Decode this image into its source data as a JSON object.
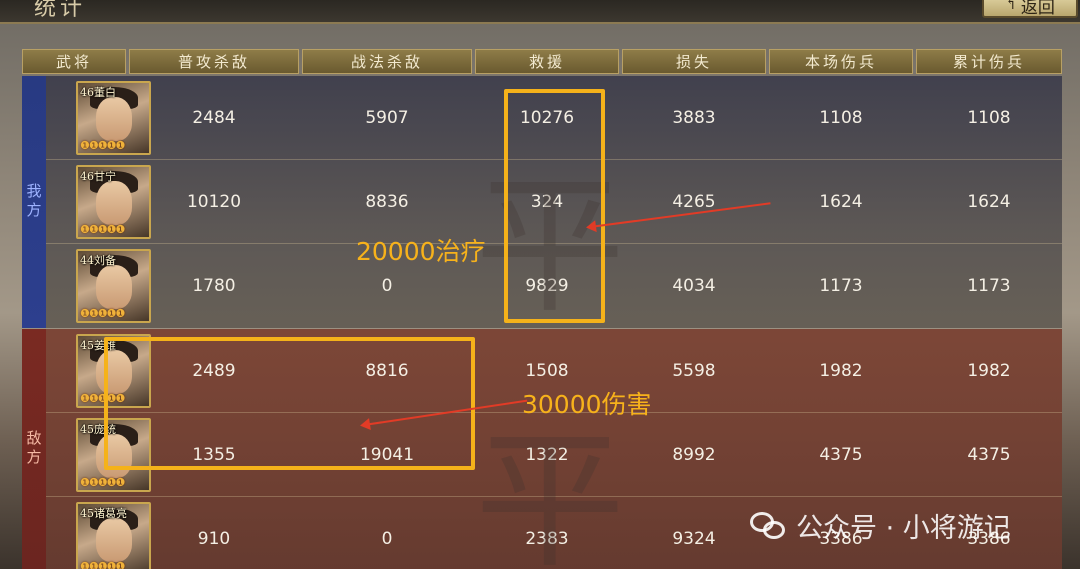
{
  "window": {
    "title": "统计",
    "back_label": "返回"
  },
  "headers": [
    "武将",
    "普攻杀敌",
    "战法杀敌",
    "救援",
    "损失",
    "本场伤兵",
    "累计伤兵"
  ],
  "ally": {
    "side_label": "我方",
    "rows": [
      {
        "hero": "46董白",
        "normal_kill": "2484",
        "skill_kill": "5907",
        "rescue": "10276",
        "loss": "3883",
        "wounded": "1108",
        "total_wounded": "1108"
      },
      {
        "hero": "46甘宁",
        "normal_kill": "10120",
        "skill_kill": "8836",
        "rescue": "324",
        "loss": "4265",
        "wounded": "1624",
        "total_wounded": "1624"
      },
      {
        "hero": "44刘备",
        "normal_kill": "1780",
        "skill_kill": "0",
        "rescue": "9829",
        "loss": "4034",
        "wounded": "1173",
        "total_wounded": "1173"
      }
    ]
  },
  "enemy": {
    "side_label": "敌方",
    "rows": [
      {
        "hero": "45姜维",
        "normal_kill": "2489",
        "skill_kill": "8816",
        "rescue": "1508",
        "loss": "5598",
        "wounded": "1982",
        "total_wounded": "1982"
      },
      {
        "hero": "45庞统",
        "normal_kill": "1355",
        "skill_kill": "19041",
        "rescue": "1322",
        "loss": "8992",
        "wounded": "4375",
        "total_wounded": "4375"
      },
      {
        "hero": "45诸葛亮",
        "normal_kill": "910",
        "skill_kill": "0",
        "rescue": "2383",
        "loss": "9324",
        "wounded": "3386",
        "total_wounded": "3386"
      }
    ]
  },
  "annotations": {
    "heal_label": "20000治疗",
    "damage_label": "30000伤害"
  },
  "watermark": {
    "char_top": "平",
    "char_bottom": "平",
    "wechat_text": "公众号 · 小将游记"
  },
  "stars": "❶❶❶❶❶",
  "colors": {
    "annotation": "#f5b21a",
    "arrow": "#e23b26",
    "ally_band": "#2d3f8e",
    "enemy_band": "#7a2a22"
  }
}
